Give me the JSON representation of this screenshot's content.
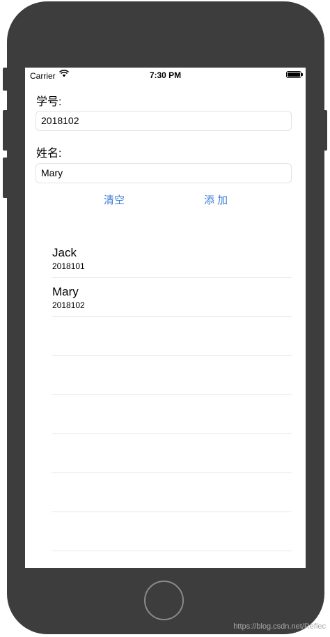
{
  "status": {
    "carrier": "Carrier",
    "time": "7:30 PM"
  },
  "form": {
    "id_label": "学号:",
    "id_value": "2018102",
    "name_label": "姓名:",
    "name_value": "Mary",
    "clear_label": "清空",
    "add_label": "添 加"
  },
  "list": {
    "items": [
      {
        "name": "Jack",
        "id": "2018101"
      },
      {
        "name": "Mary",
        "id": "2018102"
      },
      {
        "name": "",
        "id": ""
      },
      {
        "name": "",
        "id": ""
      },
      {
        "name": "",
        "id": ""
      },
      {
        "name": "",
        "id": ""
      },
      {
        "name": "",
        "id": ""
      },
      {
        "name": "",
        "id": ""
      }
    ]
  },
  "watermark": "https://blog.csdn.net/Reflec",
  "colors": {
    "accent": "#3d7fd6",
    "frame": "#3d3d3d"
  }
}
